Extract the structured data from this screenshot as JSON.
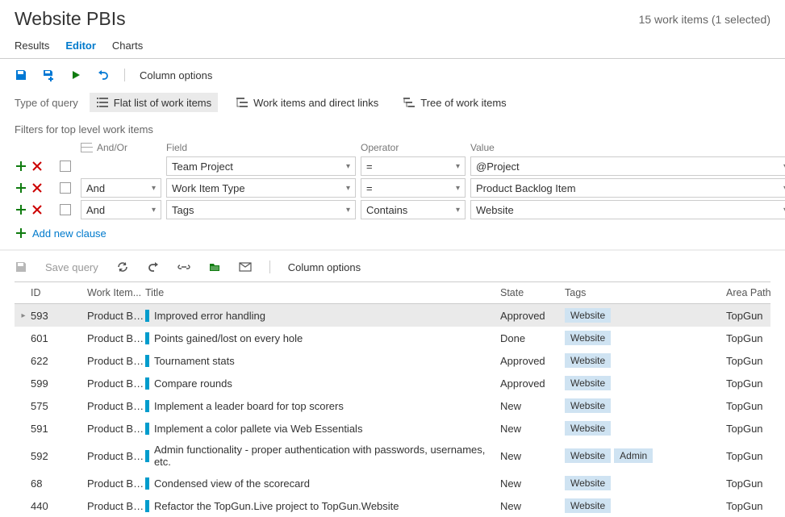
{
  "header": {
    "title": "Website PBIs",
    "count_text": "15 work items (1 selected)"
  },
  "tabs": {
    "results": "Results",
    "editor": "Editor",
    "charts": "Charts",
    "active": "editor"
  },
  "toolbar": {
    "column_options": "Column options"
  },
  "query_type": {
    "label": "Type of query",
    "flat": "Flat list of work items",
    "direct": "Work items and direct links",
    "tree": "Tree of work items"
  },
  "filters": {
    "title": "Filters for top level work items",
    "headers": {
      "andor": "And/Or",
      "field": "Field",
      "operator": "Operator",
      "value": "Value"
    },
    "rows": [
      {
        "andor": "",
        "field": "Team Project",
        "operator": "=",
        "value": "@Project"
      },
      {
        "andor": "And",
        "field": "Work Item Type",
        "operator": "=",
        "value": "Product Backlog Item"
      },
      {
        "andor": "And",
        "field": "Tags",
        "operator": "Contains",
        "value": "Website"
      }
    ],
    "add": "Add new clause"
  },
  "toolbar2": {
    "save_query": "Save query",
    "column_options": "Column options"
  },
  "results": {
    "headers": {
      "id": "ID",
      "type": "Work Item...",
      "title": "Title",
      "state": "State",
      "tags": "Tags",
      "area": "Area Path"
    },
    "rows": [
      {
        "id": "593",
        "type": "Product Ba...",
        "title": "Improved error handling",
        "state": "Approved",
        "tags": [
          "Website"
        ],
        "area": "TopGun",
        "selected": true
      },
      {
        "id": "601",
        "type": "Product Ba...",
        "title": "Points gained/lost on every hole",
        "state": "Done",
        "tags": [
          "Website"
        ],
        "area": "TopGun"
      },
      {
        "id": "622",
        "type": "Product Ba...",
        "title": "Tournament stats",
        "state": "Approved",
        "tags": [
          "Website"
        ],
        "area": "TopGun"
      },
      {
        "id": "599",
        "type": "Product Ba...",
        "title": "Compare rounds",
        "state": "Approved",
        "tags": [
          "Website"
        ],
        "area": "TopGun"
      },
      {
        "id": "575",
        "type": "Product Ba...",
        "title": "Implement a leader board for top scorers",
        "state": "New",
        "tags": [
          "Website"
        ],
        "area": "TopGun"
      },
      {
        "id": "591",
        "type": "Product Ba...",
        "title": "Implement a color pallete via Web Essentials",
        "state": "New",
        "tags": [
          "Website"
        ],
        "area": "TopGun"
      },
      {
        "id": "592",
        "type": "Product Ba...",
        "title": "Admin functionality - proper authentication with passwords, usernames, etc.",
        "state": "New",
        "tags": [
          "Website",
          "Admin"
        ],
        "area": "TopGun"
      },
      {
        "id": "68",
        "type": "Product Ba...",
        "title": "Condensed view of the scorecard",
        "state": "New",
        "tags": [
          "Website"
        ],
        "area": "TopGun"
      },
      {
        "id": "440",
        "type": "Product Ba...",
        "title": "Refactor the TopGun.Live project to TopGun.Website",
        "state": "New",
        "tags": [
          "Website"
        ],
        "area": "TopGun"
      }
    ]
  }
}
